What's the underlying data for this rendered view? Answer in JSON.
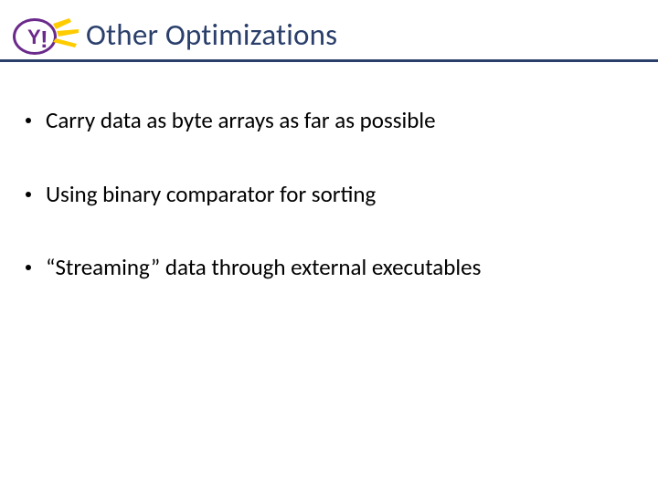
{
  "header": {
    "title": "Other Optimizations",
    "logo": {
      "name": "yahoo-logo",
      "brand_color": "#6b2a8b",
      "accent_color": "#ffcc00",
      "text": "Y!"
    }
  },
  "bullets": [
    {
      "text": "Carry data as byte arrays as far as possible"
    },
    {
      "text": "Using binary comparator for sorting"
    },
    {
      "text": "“Streaming” data through external executables"
    }
  ]
}
